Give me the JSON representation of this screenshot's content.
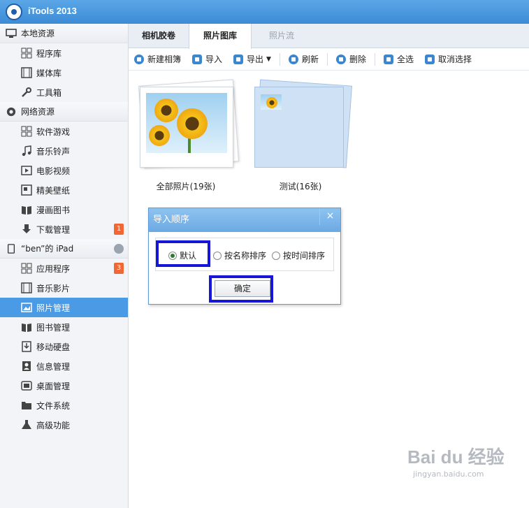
{
  "app": {
    "title": "iTools 2013"
  },
  "sidebar": {
    "sections": [
      {
        "label": "本地资源",
        "icon": "monitor-icon",
        "items": [
          {
            "label": "程序库",
            "icon": "grid-icon"
          },
          {
            "label": "媒体库",
            "icon": "film-icon"
          },
          {
            "label": "工具箱",
            "icon": "wrench-icon"
          }
        ]
      },
      {
        "label": "网络资源",
        "icon": "globe-icon",
        "items": [
          {
            "label": "软件游戏",
            "icon": "grid-icon"
          },
          {
            "label": "音乐铃声",
            "icon": "music-icon"
          },
          {
            "label": "电影视频",
            "icon": "video-icon"
          },
          {
            "label": "精美壁纸",
            "icon": "wallpaper-icon"
          },
          {
            "label": "漫画图书",
            "icon": "book-icon"
          },
          {
            "label": "下载管理",
            "icon": "download-icon",
            "badge": "1"
          }
        ]
      },
      {
        "label": "“ben”的 iPad",
        "icon": "ipad-icon",
        "items": [
          {
            "label": "应用程序",
            "icon": "grid-icon",
            "badge": "3"
          },
          {
            "label": "音乐影片",
            "icon": "film-icon"
          },
          {
            "label": "照片管理",
            "icon": "photo-icon",
            "active": true
          },
          {
            "label": "图书管理",
            "icon": "book-icon"
          },
          {
            "label": "移动硬盘",
            "icon": "drive-icon"
          },
          {
            "label": "信息管理",
            "icon": "contacts-icon"
          },
          {
            "label": "桌面管理",
            "icon": "desktop-icon"
          },
          {
            "label": "文件系统",
            "icon": "folder-icon"
          },
          {
            "label": "高级功能",
            "icon": "flask-icon"
          }
        ]
      }
    ]
  },
  "tabs": [
    {
      "label": "相机胶卷"
    },
    {
      "label": "照片图库",
      "active": true
    },
    {
      "label": "照片流"
    }
  ],
  "toolbar": {
    "new_album": "新建相簿",
    "import": "导入",
    "export": "导出",
    "refresh": "刷新",
    "delete": "删除",
    "select_all": "全选",
    "deselect": "取消选择"
  },
  "albums": [
    {
      "label": "全部照片(19张)"
    },
    {
      "label": "测试(16张)"
    }
  ],
  "dialog": {
    "title": "导入顺序",
    "close": "×",
    "options": [
      "默认",
      "按名称排序",
      "按时间排序"
    ],
    "selected": "默认",
    "confirm": "确定"
  },
  "watermark": {
    "brand": "Bai du 经验",
    "url": "jingyan.baidu.com"
  },
  "colors": {
    "accent": "#4a9ae6",
    "badge": "#f16633",
    "highlight": "#1616d8"
  }
}
